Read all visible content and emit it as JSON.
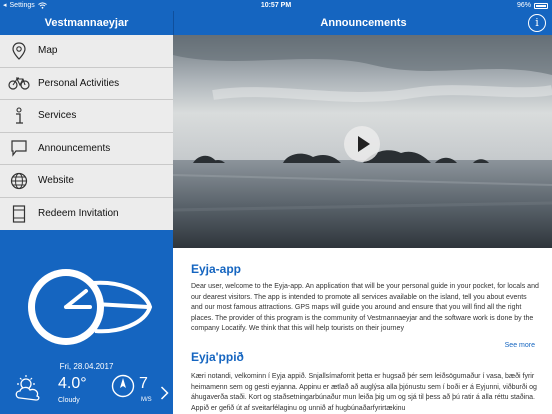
{
  "status_bar": {
    "carrier": "Settings",
    "time": "10:57 PM",
    "battery": "96%"
  },
  "sidebar": {
    "title": "Vestmannaeyjar",
    "items": [
      {
        "label": "Map",
        "icon": "map-pin-icon"
      },
      {
        "label": "Personal Activities",
        "icon": "bicycle-icon"
      },
      {
        "label": "Services",
        "icon": "info-icon"
      },
      {
        "label": "Announcements",
        "icon": "speech-bubble-icon"
      },
      {
        "label": "Website",
        "icon": "globe-icon"
      },
      {
        "label": "Redeem Invitation",
        "icon": "document-icon"
      }
    ],
    "weather": {
      "date": "Fri, 28.04.2017",
      "temperature": "4.0°",
      "condition": "Cloudy",
      "wind_speed": "7",
      "wind_unit": "M/S"
    }
  },
  "header": {
    "title": "Announcements"
  },
  "articles": [
    {
      "title": "Eyja-app",
      "body": "Dear user, welcome to the Eyja-app. An application that will be your personal guide in your pocket, for locals and our dearest visitors. The app is intended to promote all services available on the island, tell you about events and our most famous attractions. GPS maps will guide you around and ensure that you will find all the right places. The provider of this program is the community of Vestmannaeyjar and the software work is done by the company Locatify. We think that this will help tourists on their journey",
      "more": "See more"
    },
    {
      "title": "Eyja'ppið",
      "body": "Kæri notandi, velkominn í Eyja appið. Snjallsímaforrit þetta er hugsað þér sem leiðsögumaður í vasa, bæði fyrir heimamenn sem og gesti eyjanna. Appinu er ætlað að auglýsa alla þjónustu sem í boði er á Eyjunni, viðburði og áhugaverða staði. Kort og staðsetningarbúnaður mun leiða þig um og sjá til þess að þú ratir á alla réttu staðina. Appið er gefið út af sveitarfélaginu og unnið af hugbúnaðarfyrirtækinu"
    }
  ],
  "colors": {
    "brand_blue": "#1565c0",
    "menu_bg": "#ececec"
  }
}
